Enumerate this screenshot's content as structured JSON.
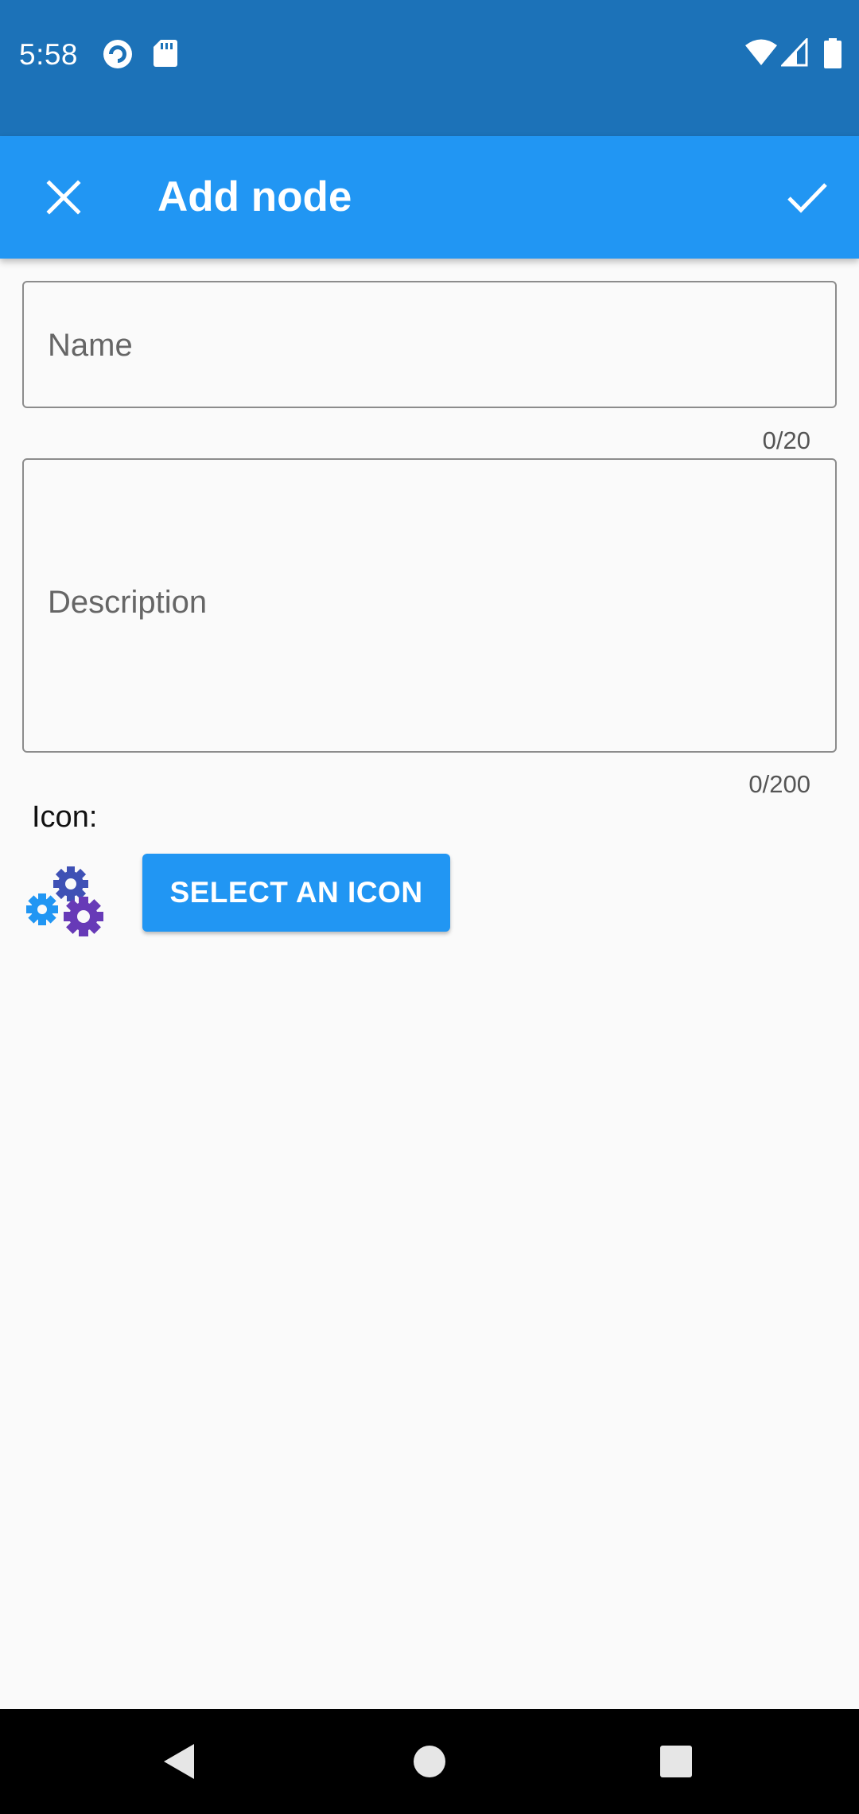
{
  "status_bar": {
    "time": "5:58",
    "left_icons": [
      "pocket-casts-icon",
      "sd-card-icon"
    ],
    "right_icons": [
      "wifi-icon",
      "signal-icon",
      "battery-icon"
    ]
  },
  "app_bar": {
    "title": "Add node",
    "close_icon": "close-icon",
    "confirm_icon": "check-icon"
  },
  "form": {
    "name": {
      "placeholder": "Name",
      "value": "",
      "counter": "0/20"
    },
    "description": {
      "placeholder": "Description",
      "value": "",
      "counter": "0/200"
    },
    "icon_label": "Icon:",
    "icon_preview": "gears-icon",
    "select_icon_button": "SELECT AN ICON"
  },
  "nav_bar": {
    "buttons": [
      "back-icon",
      "home-icon",
      "recents-icon"
    ]
  },
  "colors": {
    "status_bar": "#1c72b8",
    "primary": "#2196f3",
    "background": "#fafafa",
    "gear_blue": "#2196f3",
    "gear_indigo": "#3f51b5",
    "gear_purple": "#673ab7"
  }
}
